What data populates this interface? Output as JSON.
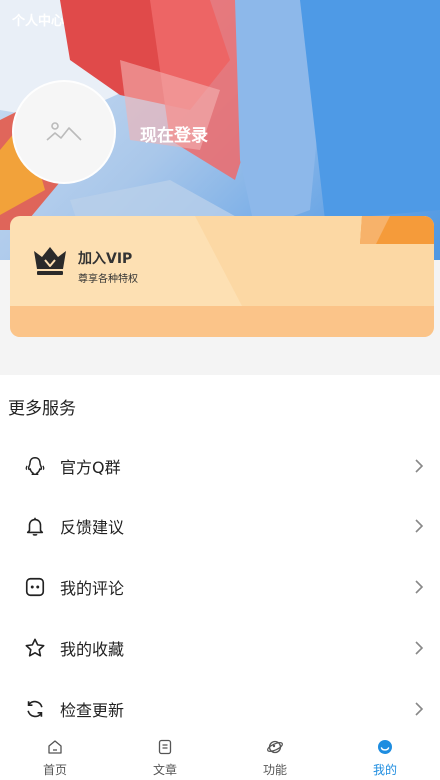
{
  "header": {
    "title": "个人中心",
    "login_label": "现在登录"
  },
  "vip": {
    "title": "加入VIP",
    "subtitle": "尊享各种特权"
  },
  "services": {
    "section_title": "更多服务",
    "items": [
      {
        "label": "官方Q群",
        "icon": "qq-group-icon"
      },
      {
        "label": "反馈建议",
        "icon": "bell-icon"
      },
      {
        "label": "我的评论",
        "icon": "comment-icon"
      },
      {
        "label": "我的收藏",
        "icon": "star-icon"
      },
      {
        "label": "检查更新",
        "icon": "refresh-icon"
      }
    ]
  },
  "tabs": [
    {
      "label": "首页",
      "icon": "home-icon"
    },
    {
      "label": "文章",
      "icon": "article-icon"
    },
    {
      "label": "功能",
      "icon": "function-icon"
    },
    {
      "label": "我的",
      "icon": "profile-icon",
      "active": true
    }
  ],
  "colors": {
    "accent": "#1e8de0",
    "vip_card": "#fde0b3",
    "vip_stripe": "#fbc489"
  }
}
